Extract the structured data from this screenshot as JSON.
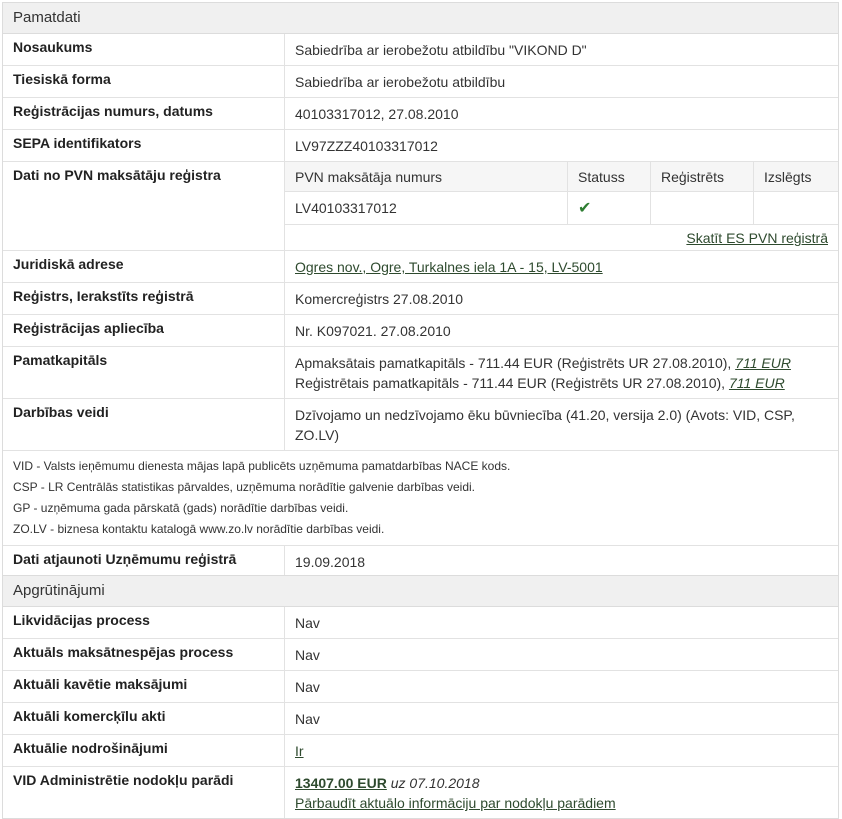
{
  "pamatdati": {
    "title": "Pamatdati",
    "nosaukums": {
      "label": "Nosaukums",
      "value": "Sabiedrība ar ierobežotu atbildību \"VIKOND D\""
    },
    "forma": {
      "label": "Tiesiskā forma",
      "value": "Sabiedrība ar ierobežotu atbildību"
    },
    "reg": {
      "label": "Reģistrācijas numurs, datums",
      "value": "40103317012, 27.08.2010"
    },
    "sepa": {
      "label": "SEPA identifikators",
      "value": "LV97ZZZ40103317012"
    },
    "pvn": {
      "label": "Dati no PVN maksātāju reģistra",
      "headers": [
        "PVN maksātāja numurs",
        "Statuss",
        "Reģistrēts",
        "Izslēgts"
      ],
      "number": "LV40103317012",
      "status_icon": "check-icon",
      "status_color": "#2e7d32",
      "link": "Skatīt ES PVN reģistrā"
    },
    "adrese": {
      "label": "Juridiskā adrese",
      "value": "Ogres nov., Ogre, Turkalnes iela 1A - 15, LV-5001"
    },
    "registrs": {
      "label": "Reģistrs, Ierakstīts reģistrā",
      "value": "Komercreģistrs 27.08.2010"
    },
    "apliecība": {
      "label": "Reģistrācijas apliecība",
      "value": "Nr. K097021. 27.08.2010"
    },
    "kapitals": {
      "label": "Pamatkapitāls",
      "line1": "Apmaksātais pamatkapitāls - 711.44 EUR (Reģistrēts UR 27.08.2010),",
      "line1_link": "711 EUR",
      "line2": "Reģistrētais pamatkapitāls - 711.44 EUR (Reģistrēts UR 27.08.2010),",
      "line2_link": "711 EUR"
    },
    "darbibas": {
      "label": "Darbības veidi",
      "value": "Dzīvojamo un nedzīvojamo ēku būvniecība (41.20, versija 2.0) (Avots: VID, CSP, ZO.LV)"
    },
    "notes": [
      "VID - Valsts ieņēmumu dienesta mājas lapā publicēts uzņēmuma pamatdarbības NACE kods.",
      "CSP - LR Centrālās statistikas pārvaldes, uzņēmuma norādītie galvenie darbības veidi.",
      "GP - uzņēmuma gada pārskatā (gads) norādītie darbības veidi.",
      "ZO.LV - biznesa kontaktu katalogā www.zo.lv norādītie darbības veidi."
    ],
    "atjaunoti": {
      "label": "Dati atjaunoti Uzņēmumu reģistrā",
      "value": "19.09.2018"
    }
  },
  "apgrutinajumi": {
    "title": "Apgrūtinājumi",
    "rows": [
      {
        "label": "Likvidācijas process",
        "value": "Nav"
      },
      {
        "label": "Aktuāls maksātnespējas process",
        "value": "Nav"
      },
      {
        "label": "Aktuāli kavētie maksājumi",
        "value": "Nav"
      },
      {
        "label": "Aktuāli komercķīlu akti",
        "value": "Nav"
      },
      {
        "label": "Aktuālie nodrošinājumi",
        "value": "Ir"
      }
    ],
    "vid": {
      "label": "VID Administrētie nodokļu parādi",
      "amount": "13407.00 EUR",
      "date": "uz 07.10.2018",
      "link": "Pārbaudīt aktuālo informāciju par nodokļu parādiem"
    }
  }
}
